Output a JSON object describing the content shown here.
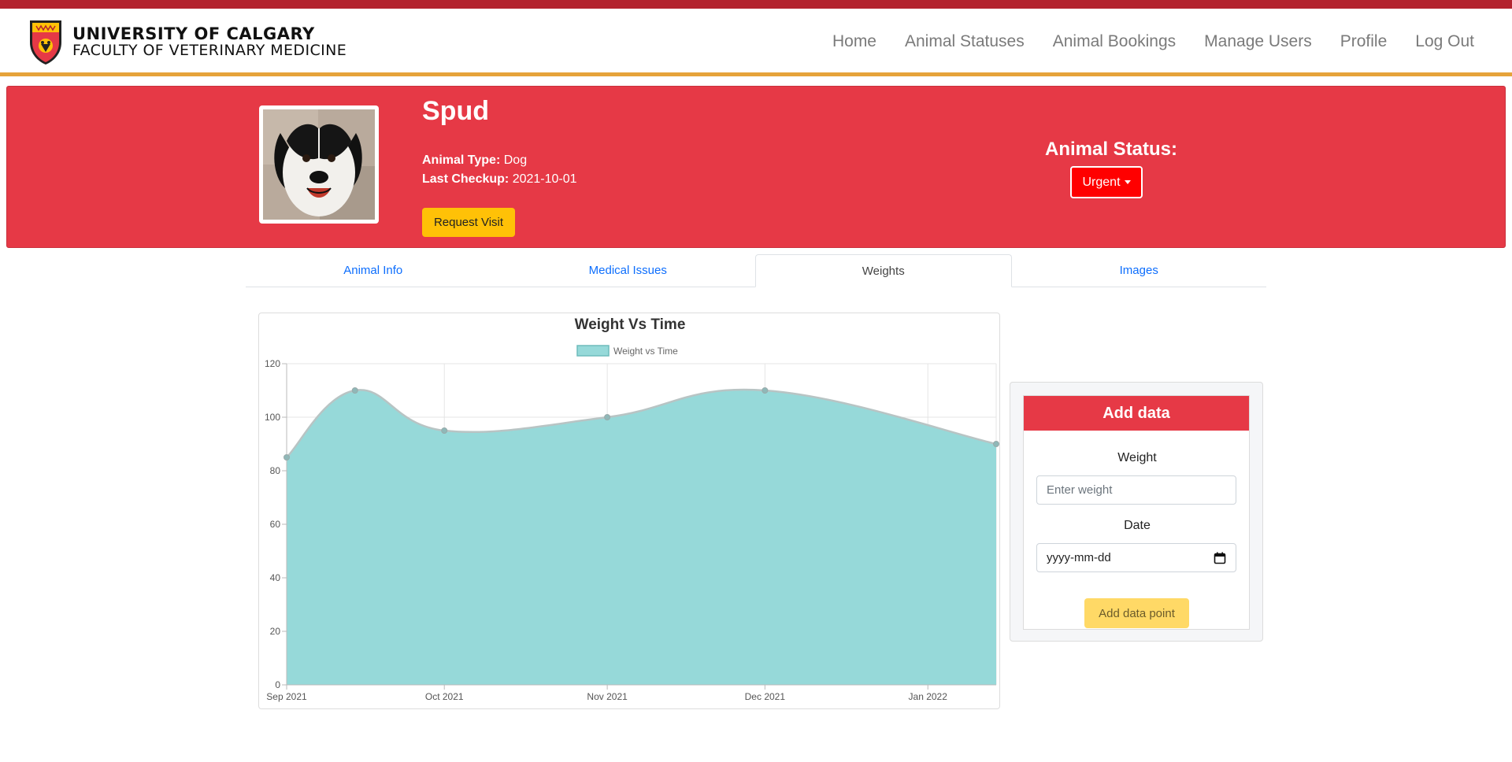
{
  "brand": {
    "university": "UNIVERSITY OF CALGARY",
    "faculty": "FACULTY OF VETERINARY MEDICINE"
  },
  "nav": {
    "items": [
      "Home",
      "Animal Statuses",
      "Animal Bookings",
      "Manage Users",
      "Profile",
      "Log Out"
    ]
  },
  "animal": {
    "name": "Spud",
    "type_label": "Animal Type:",
    "type": "Dog",
    "checkup_label": "Last Checkup:",
    "last_checkup": "2021-10-01",
    "request_button": "Request Visit",
    "status_label": "Animal Status:",
    "status": "Urgent"
  },
  "tabs": [
    {
      "label": "Animal Info",
      "active": false
    },
    {
      "label": "Medical Issues",
      "active": false
    },
    {
      "label": "Weights",
      "active": true
    },
    {
      "label": "Images",
      "active": false
    }
  ],
  "add_data": {
    "title": "Add data",
    "weight_label": "Weight",
    "weight_placeholder": "Enter weight",
    "date_label": "Date",
    "date_placeholder": "yyyy-mm-dd",
    "button": "Add data point"
  },
  "colors": {
    "accent_red": "#e63946",
    "topbar": "#b3232e",
    "nav_underline": "#e6a33a",
    "status": "#ff0000",
    "button_yellow": "#ffc107",
    "chart_fill": "#96d9d9"
  },
  "chart_data": {
    "type": "area",
    "title": "Weight Vs Time",
    "series": [
      {
        "name": "Weight vs Time",
        "points": [
          {
            "x": "2021-09-01",
            "y": 85
          },
          {
            "x": "2021-09-14",
            "y": 110
          },
          {
            "x": "2021-10-01",
            "y": 95
          },
          {
            "x": "2021-11-01",
            "y": 100
          },
          {
            "x": "2021-12-01",
            "y": 110
          },
          {
            "x": "2022-01-14",
            "y": 90
          }
        ]
      }
    ],
    "x_ticks": [
      "Sep 2021",
      "Oct 2021",
      "Nov 2021",
      "Dec 2021",
      "Jan 2022"
    ],
    "xlim": [
      "2021-09-01",
      "2022-01-14"
    ],
    "y_ticks": [
      0,
      20,
      40,
      60,
      80,
      100,
      120
    ],
    "ylim": [
      0,
      120
    ],
    "grid": true,
    "legend": "top"
  }
}
